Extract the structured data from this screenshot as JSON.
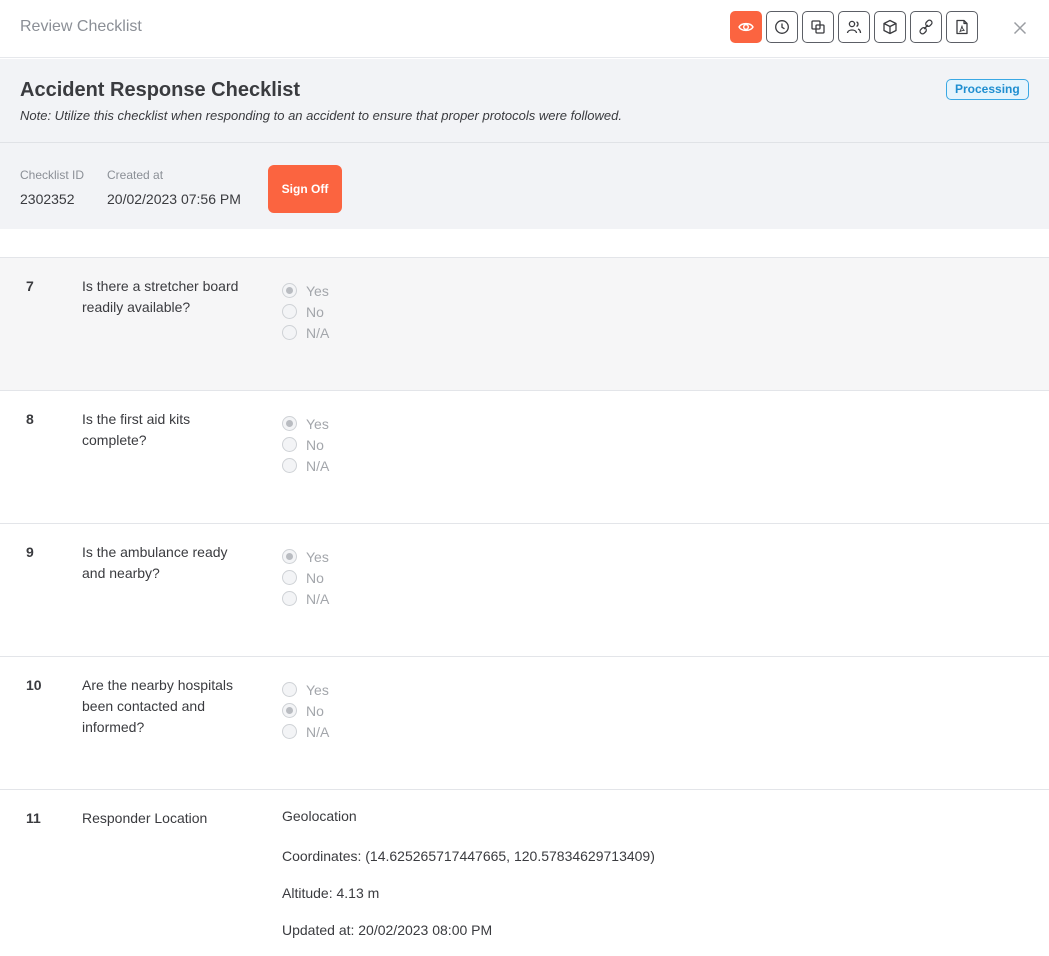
{
  "window": {
    "title": "Review Checklist",
    "toolbar": [
      "eye-icon",
      "history-icon",
      "copy-icon",
      "users-icon",
      "box-icon",
      "link-icon",
      "pdf-icon"
    ],
    "accent": "#fb6440"
  },
  "checklist": {
    "title": "Accident Response Checklist",
    "note": "Note: Utilize this checklist when responding to an accident to ensure that proper protocols were followed.",
    "status": "Processing",
    "id_label": "Checklist ID",
    "id": "2302352",
    "created_label": "Created at",
    "created_at": "20/02/2023 07:56 PM",
    "sign_off_label": "Sign Off"
  },
  "options": [
    "Yes",
    "No",
    "N/A"
  ],
  "questions": [
    {
      "number": "7",
      "text": "Is there a stretcher board readily available?",
      "selected": "Yes"
    },
    {
      "number": "8",
      "text": "Is the first aid kits complete?",
      "selected": "Yes"
    },
    {
      "number": "9",
      "text": "Is the ambulance ready and nearby?",
      "selected": "Yes"
    },
    {
      "number": "10",
      "text": "Are the nearby hospitals been contacted and informed?",
      "selected": "No"
    }
  ],
  "location": {
    "number": "11",
    "label": "Responder Location",
    "heading": "Geolocation",
    "coordinates": "Coordinates: (14.625265717447665, 120.57834629713409)",
    "altitude": "Altitude: 4.13 m",
    "updated": "Updated at: 20/02/2023 08:00 PM"
  }
}
